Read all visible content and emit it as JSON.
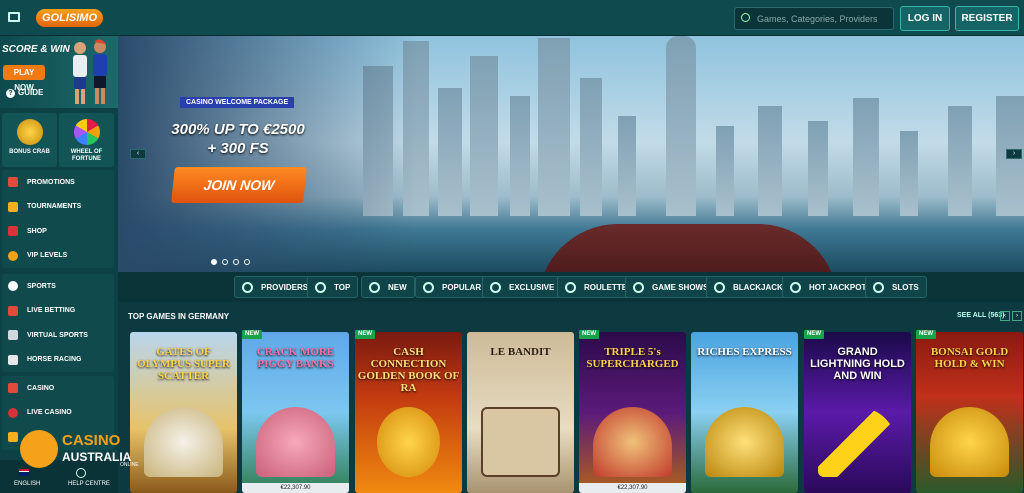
{
  "header": {
    "logo": "GOLISIMO",
    "search_placeholder": "Games, Categories, Providers",
    "login_label": "LOG IN",
    "register_label": "REGISTER"
  },
  "sidebar": {
    "score": {
      "title": "SCORE & WIN",
      "play_label": "PLAY NOW",
      "guide_label": "GUIDE"
    },
    "tiles": [
      {
        "label": "BONUS CRAB"
      },
      {
        "label": "WHEEL OF FORTUNE"
      }
    ],
    "group1": [
      {
        "label": "PROMOTIONS"
      },
      {
        "label": "TOURNAMENTS"
      },
      {
        "label": "SHOP"
      },
      {
        "label": "VIP LEVELS"
      }
    ],
    "group2": [
      {
        "label": "SPORTS"
      },
      {
        "label": "LIVE BETTING"
      },
      {
        "label": "VIRTUAL SPORTS"
      },
      {
        "label": "HORSE RACING"
      }
    ],
    "group3": [
      {
        "label": "CASINO"
      },
      {
        "label": "LIVE CASINO"
      }
    ],
    "footer": {
      "language": "ENGLISH",
      "help": "HELP CENTRE"
    }
  },
  "hero": {
    "badge": "CASINO WELCOME PACKAGE",
    "promo_line1": "300% UP TO €2500",
    "promo_line2": "+ 300 FS",
    "cta": "JOIN NOW",
    "prev": "‹",
    "next": "›"
  },
  "categories": [
    {
      "label": "PROVIDERS"
    },
    {
      "label": "TOP"
    },
    {
      "label": "NEW"
    },
    {
      "label": "POPULAR"
    },
    {
      "label": "EXCLUSIVE"
    },
    {
      "label": "ROULETTE"
    },
    {
      "label": "GAME SHOWS"
    },
    {
      "label": "BLACKJACK"
    },
    {
      "label": "HOT JACKPOTS"
    },
    {
      "label": "SLOTS"
    }
  ],
  "section": {
    "title": "TOP GAMES IN GERMANY",
    "see_all": "SEE ALL (563)"
  },
  "games": [
    {
      "title": "GATES OF OLYMPUS SUPER SCATTER",
      "new": "",
      "price": ""
    },
    {
      "title": "CRACK MORE PIGGY BANKS",
      "new": "NEW",
      "price": "€22,307.90"
    },
    {
      "title": "CASH CONNECTION GOLDEN BOOK OF RA",
      "new": "NEW",
      "price": ""
    },
    {
      "title": "LE BANDIT",
      "new": "",
      "price": ""
    },
    {
      "title": "TRIPLE 5's SUPERCHARGED",
      "new": "NEW",
      "price": "€22,307.90"
    },
    {
      "title": "RICHES EXPRESS",
      "new": "",
      "price": ""
    },
    {
      "title": "GRAND LIGHTNING HOLD AND WIN",
      "new": "NEW",
      "price": ""
    },
    {
      "title": "BONSAI GOLD HOLD & WIN",
      "new": "NEW",
      "price": ""
    }
  ],
  "watermark": {
    "line1": "CASINO",
    "line2": "AUSTRALIA",
    "line3": "ONLINE"
  }
}
